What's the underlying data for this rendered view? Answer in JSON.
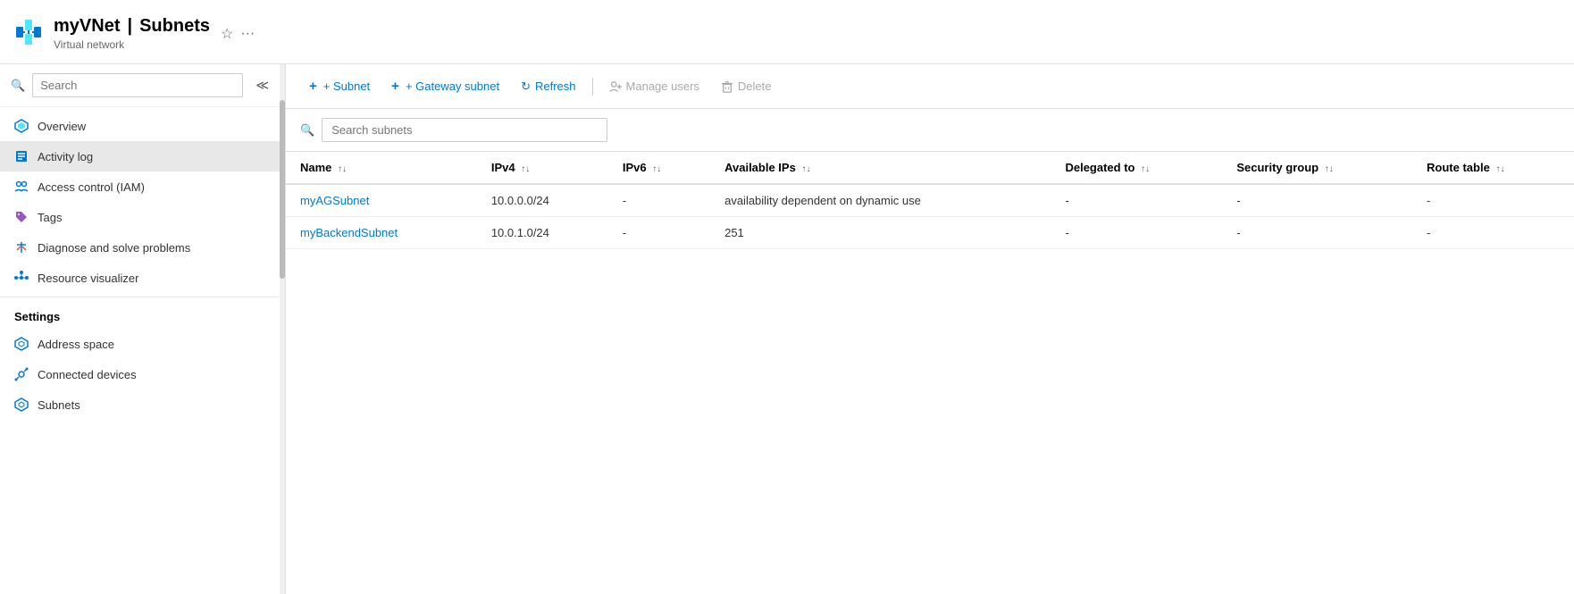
{
  "header": {
    "resource_name": "myVNet",
    "separator": "|",
    "page_title": "Subnets",
    "resource_type": "Virtual network"
  },
  "sidebar": {
    "search_placeholder": "Search",
    "nav_items": [
      {
        "id": "overview",
        "label": "Overview",
        "icon": "vnet",
        "active": false
      },
      {
        "id": "activity-log",
        "label": "Activity log",
        "icon": "list",
        "active": true
      },
      {
        "id": "access-control",
        "label": "Access control (IAM)",
        "icon": "people",
        "active": false
      },
      {
        "id": "tags",
        "label": "Tags",
        "icon": "tag",
        "active": false
      },
      {
        "id": "diagnose",
        "label": "Diagnose and solve problems",
        "icon": "wrench",
        "active": false
      },
      {
        "id": "resource-visualizer",
        "label": "Resource visualizer",
        "icon": "cluster",
        "active": false
      }
    ],
    "settings_label": "Settings",
    "settings_items": [
      {
        "id": "address-space",
        "label": "Address space",
        "icon": "vnet",
        "active": false
      },
      {
        "id": "connected-devices",
        "label": "Connected devices",
        "icon": "plug",
        "active": false
      },
      {
        "id": "subnets",
        "label": "Subnets",
        "icon": "vnet",
        "active": false
      }
    ]
  },
  "toolbar": {
    "add_subnet_label": "+ Subnet",
    "add_gateway_label": "+ Gateway subnet",
    "refresh_label": "Refresh",
    "manage_users_label": "Manage users",
    "delete_label": "Delete"
  },
  "content": {
    "search_placeholder": "Search subnets",
    "table": {
      "columns": [
        {
          "id": "name",
          "label": "Name"
        },
        {
          "id": "ipv4",
          "label": "IPv4"
        },
        {
          "id": "ipv6",
          "label": "IPv6"
        },
        {
          "id": "available-ips",
          "label": "Available IPs"
        },
        {
          "id": "delegated-to",
          "label": "Delegated to"
        },
        {
          "id": "security-group",
          "label": "Security group"
        },
        {
          "id": "route-table",
          "label": "Route table"
        }
      ],
      "rows": [
        {
          "name": "myAGSubnet",
          "ipv4": "10.0.0.0/24",
          "ipv6": "-",
          "available_ips": "availability dependent on dynamic use",
          "delegated_to": "-",
          "security_group": "-",
          "route_table": "-"
        },
        {
          "name": "myBackendSubnet",
          "ipv4": "10.0.1.0/24",
          "ipv6": "-",
          "available_ips": "251",
          "delegated_to": "-",
          "security_group": "-",
          "route_table": "-"
        }
      ]
    }
  }
}
